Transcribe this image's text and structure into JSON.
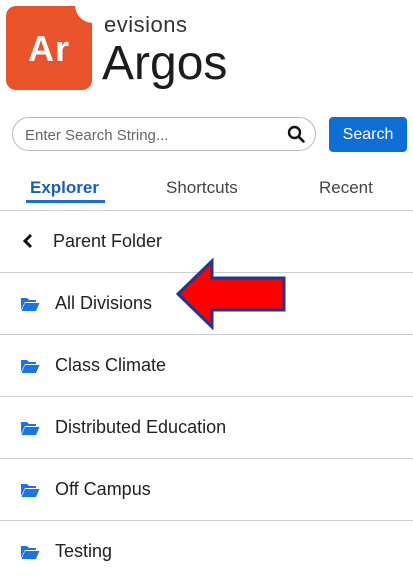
{
  "brand": {
    "logo_text": "Ar",
    "company": "evisions",
    "product": "Argos",
    "accent": "#e8532c"
  },
  "search": {
    "placeholder": "Enter Search String...",
    "value": "",
    "button_label": "Search",
    "button_color": "#0d6ed8"
  },
  "tabs": [
    {
      "label": "Explorer",
      "active": true
    },
    {
      "label": "Shortcuts",
      "active": false
    },
    {
      "label": "Recent",
      "active": false
    }
  ],
  "list": {
    "parent": {
      "label": "Parent Folder",
      "icon": "chevron-left-icon"
    },
    "folders": [
      {
        "label": "All Divisions",
        "icon": "folder-open-icon"
      },
      {
        "label": "Class Climate",
        "icon": "folder-open-icon"
      },
      {
        "label": "Distributed Education",
        "icon": "folder-open-icon"
      },
      {
        "label": "Off Campus",
        "icon": "folder-open-icon"
      },
      {
        "label": "Testing",
        "icon": "folder-open-icon"
      }
    ],
    "folder_icon_color": "#1a73e8"
  },
  "annotation": {
    "arrow_color": "#ff0000",
    "arrow_outline": "#1a3a8f",
    "points_to": "All Divisions"
  }
}
